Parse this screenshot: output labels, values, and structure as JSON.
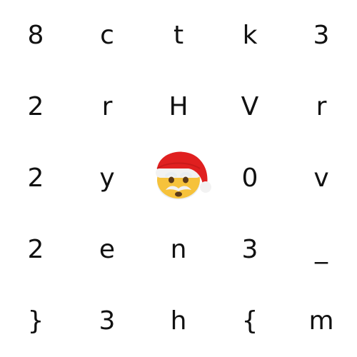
{
  "grid": {
    "rows": [
      [
        "8",
        "c",
        "t",
        "k",
        "3"
      ],
      [
        "2",
        "r",
        "H",
        "V",
        "r"
      ],
      [
        "2",
        "y",
        "",
        "0",
        "v"
      ],
      [
        "2",
        "e",
        "n",
        "3",
        "_"
      ],
      [
        "}",
        "3",
        "h",
        "{",
        "m"
      ]
    ],
    "emoji": {
      "row": 2,
      "col": 2,
      "icon": "santa-claus-icon"
    }
  },
  "colors": {
    "text": "#111111",
    "background": "#ffffff",
    "hat_red": "#e02020",
    "hat_white": "#f2f2f2",
    "face": "#f6c23b",
    "beard": "#e9eef2"
  }
}
